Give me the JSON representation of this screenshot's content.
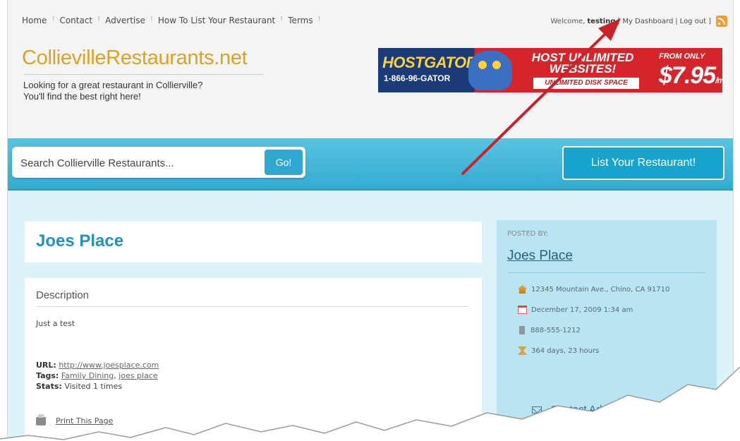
{
  "header": {
    "nav": [
      "Home",
      "Contact",
      "Advertise",
      "How To List Your Restaurant",
      "Terms"
    ],
    "welcome_text": "Welcome,",
    "username": "testing",
    "bracket_open": "[",
    "dashboard_link": "My Dashboard",
    "pipe": "|",
    "logout_link": "Log out",
    "bracket_close": "]",
    "rss_icon": "rss-feed-icon",
    "logo": "CollievilleRestaurants.net",
    "tagline_line1": "Looking for a great restaurant in Collierville?",
    "tagline_line2": "You'll find the best right here!"
  },
  "banner": {
    "brand": "HOSTGATOR",
    "phone": "1-866-96-GATOR",
    "headline_line1": "HOST UNLIMITED",
    "headline_line2": "WEBSITES!",
    "strip": "UNLIMITED DISK SPACE",
    "from_only": "FROM ONLY",
    "price": "$7.95",
    "per": "/mo"
  },
  "search": {
    "placeholder": "Search Collierville Restaurants...",
    "go_label": "Go!"
  },
  "list_button": "List Your Restaurant!",
  "listing": {
    "title": "Joes Place",
    "description_heading": "Description",
    "description": "Just a test",
    "url_label": "URL:",
    "url": "http://www.joesplace.com",
    "tags_label": "Tags:",
    "tags": [
      "Family Dining",
      "joes place"
    ],
    "tags_separator": ",",
    "stats_label": "Stats:",
    "stats": "Visited 1 times",
    "print_label": "Print This Page"
  },
  "sidebar": {
    "posted_by": "POSTED BY:",
    "name": "Joes Place",
    "address": "12345 Mountain Ave., Chino, CA 91710",
    "date": "December 17, 2009 1:34 am",
    "phone": "888-555-1212",
    "remaining": "364 days, 23 hours",
    "contact": "Contact Ad Owner"
  },
  "colors": {
    "logo": "#d9a326",
    "bar": "#3db5da",
    "title": "#2690bd",
    "arrow": "#c8222b"
  }
}
